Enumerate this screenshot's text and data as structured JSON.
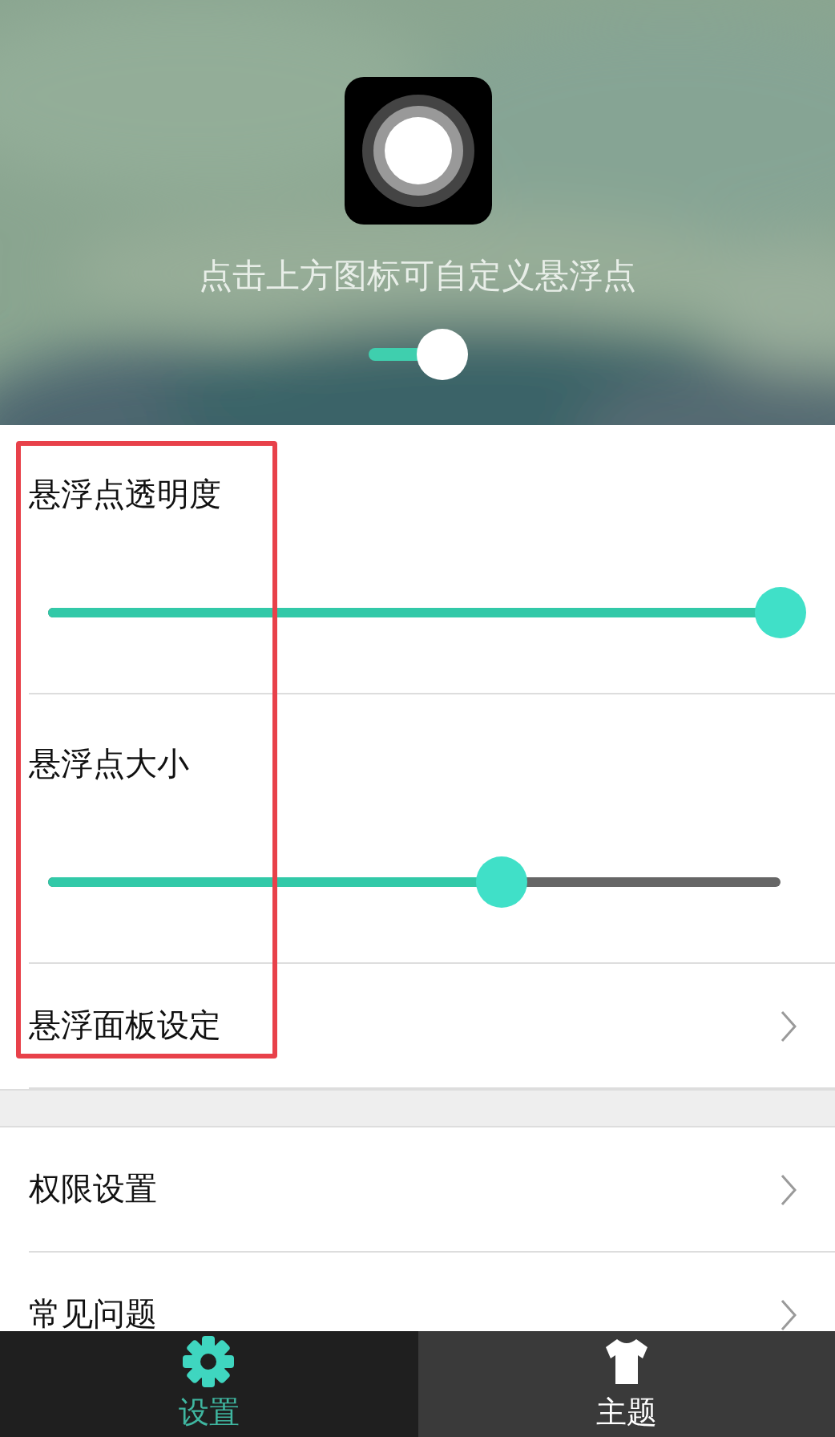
{
  "header": {
    "hint": "点击上方图标可自定义悬浮点",
    "toggle": {
      "on": true
    }
  },
  "settings": [
    {
      "kind": "slider",
      "label": "悬浮点透明度",
      "level": 1.0
    },
    {
      "kind": "slider",
      "label": "悬浮点大小",
      "level": 0.62
    },
    {
      "kind": "link",
      "label": "悬浮面板设定"
    }
  ],
  "more": [
    {
      "kind": "link",
      "label": "权限设置"
    },
    {
      "kind": "link",
      "label": "常见问题"
    }
  ],
  "tabs": [
    {
      "label": "设置",
      "selected": true
    },
    {
      "label": "主题",
      "selected": false
    }
  ]
}
